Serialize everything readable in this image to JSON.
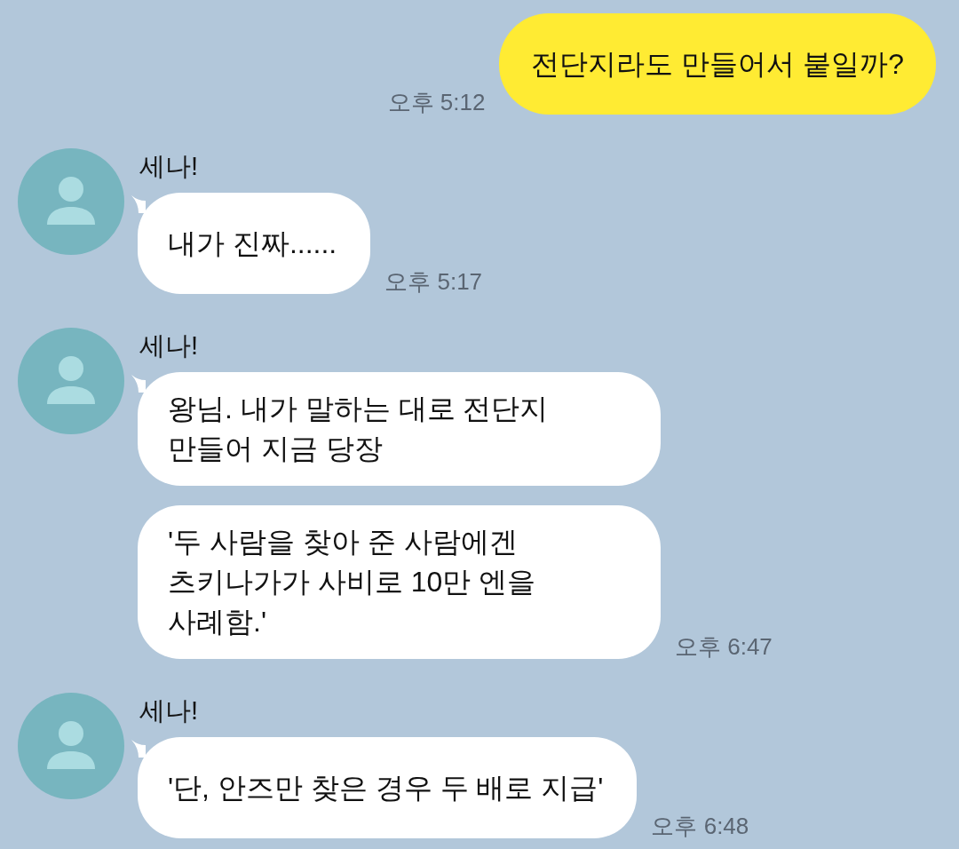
{
  "chat": [
    {
      "kind": "outgoing",
      "bubbles": [
        {
          "text": "전단지라도 만들어서 붙일까?",
          "time": "오후 5:12"
        }
      ]
    },
    {
      "kind": "incoming",
      "sender": "세나!",
      "bubbles": [
        {
          "text": "내가 진짜......",
          "time": "오후 5:17"
        }
      ]
    },
    {
      "kind": "incoming",
      "sender": "세나!",
      "bubbles": [
        {
          "text": "왕님. 내가 말하는 대로 전단지 만들어 지금 당장"
        },
        {
          "text": "'두 사람을 찾아 준 사람에겐 츠키나가가 사비로 10만 엔을 사례함.'",
          "time": "오후 6:47"
        }
      ]
    },
    {
      "kind": "incoming",
      "sender": "세나!",
      "bubbles": [
        {
          "text": "'단, 안즈만 찾은 경우 두 배로 지급'",
          "time": "오후 6:48"
        }
      ]
    }
  ]
}
